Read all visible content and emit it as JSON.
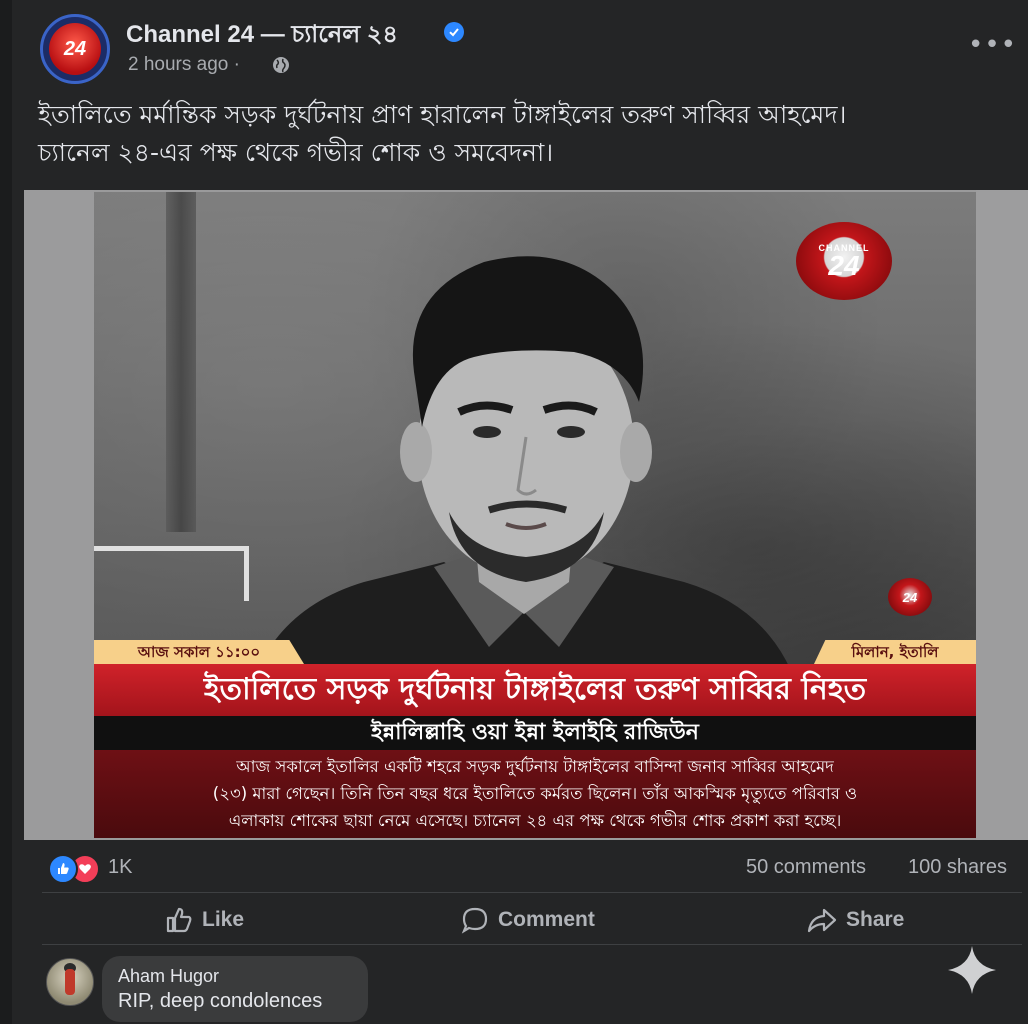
{
  "post": {
    "page_name": "Channel 24 — চ্যানেল ২৪",
    "avatar_text": "24",
    "time": "2 hours ago ·",
    "caption_line1": "ইতালিতে মর্মান্তিক সড়ক দুর্ঘটনায় প্রাণ হারালেন টাঙ্গাইলের তরুণ সাব্বির আহমেদ।",
    "caption_line2": "চ্যানেল ২৪-এর পক্ষ থেকে গভীর শোক ও সমবেদনা।"
  },
  "media": {
    "logo_label": "CHANNEL",
    "logo_number": "24",
    "small_logo": "24",
    "time_tag": "আজ সকাল ১১:০০",
    "place_tag": "মিলান, ইতালি",
    "headline": "ইতালিতে সড়ক দুর্ঘটনায় টাঙ্গাইলের তরুণ সাব্বির নিহত",
    "subline": "ইন্নালিল্লাহি ওয়া ইন্না ইলাইহি রাজিউন",
    "body_line1": "আজ সকালে ইতালির একটি শহরে সড়ক দুর্ঘটনায় টাঙ্গাইলের বাসিন্দা জনাব সাব্বির আহমেদ",
    "body_line2": "(২৩) মারা গেছেন। তিনি তিন বছর ধরে ইতালিতে কর্মরত ছিলেন। তাঁর আকস্মিক মৃত্যুতে পরিবার ও",
    "body_line3": "এলাকায় শোকের ছায়া নেমে এসেছে। চ্যানেল ২৪ এর পক্ষ থেকে গভীর শোক প্রকাশ করা হচ্ছে।"
  },
  "stats": {
    "reactions": "1K",
    "comments": "50 comments",
    "shares": "100 shares"
  },
  "actions": {
    "like": "Like",
    "comment": "Comment",
    "share": "Share"
  },
  "comment": {
    "author": "Aham Hugor",
    "text": "RIP, deep condolences"
  },
  "colors": {
    "background": "#242526",
    "accent_blue": "#2d88ff",
    "love_red": "#f33e58",
    "headline_red": "#c41e25",
    "tag_yellow": "#f7d08a"
  },
  "icons": [
    "verified-badge-icon",
    "globe-icon",
    "more-options-icon",
    "like-reaction-icon",
    "love-reaction-icon",
    "like-icon",
    "comment-icon",
    "share-icon",
    "sparkle-icon"
  ]
}
